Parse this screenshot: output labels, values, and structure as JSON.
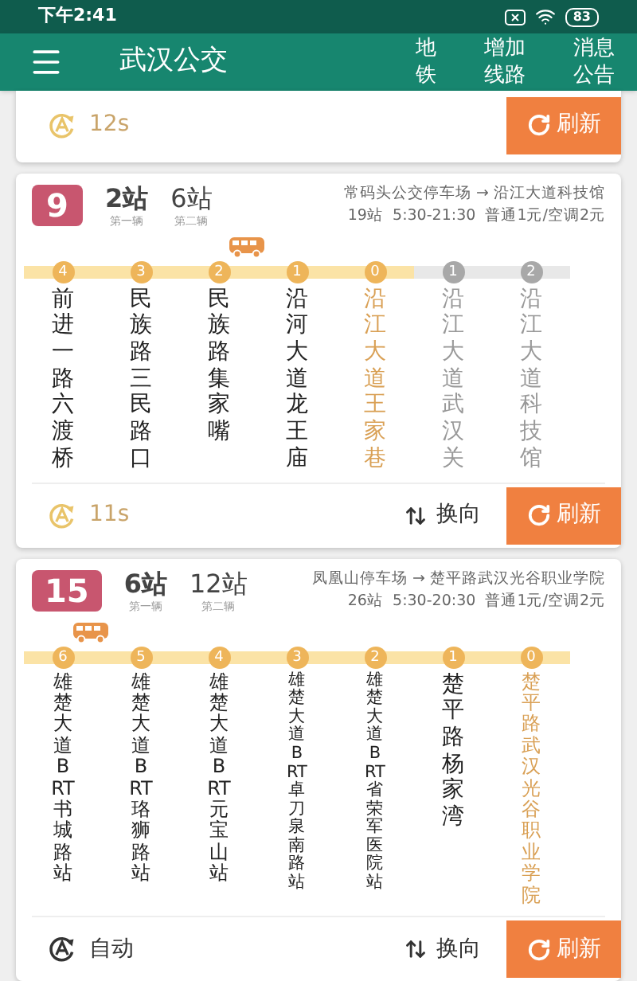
{
  "status_bar": {
    "time": "下午2:41",
    "battery": "83"
  },
  "app_bar": {
    "title": "武汉公交",
    "actions": [
      {
        "lines": [
          "地",
          "铁"
        ]
      },
      {
        "lines": [
          "增加",
          "线路"
        ]
      },
      {
        "lines": [
          "消息",
          "公告"
        ]
      }
    ]
  },
  "cards": [
    {
      "kind": "footer_only",
      "auto_refresh": false,
      "footer_label": "12s",
      "refresh": "刷新"
    },
    {
      "kind": "line",
      "route": "9",
      "first_bus": {
        "stops": "2站",
        "label": "第一辆"
      },
      "second_bus": {
        "stops": "6站",
        "label": "第二辆"
      },
      "direction": "常码头公交停车场 → 沿江大道科技馆",
      "info": "19站  5:30-21:30  普通1元/空调2元",
      "stations": [
        {
          "count": "4",
          "name": "前进一路六渡桥",
          "reached": true,
          "current": false,
          "bus": false
        },
        {
          "count": "3",
          "name": "民族路三民路口",
          "reached": true,
          "current": false,
          "bus": false
        },
        {
          "count": "2",
          "name": "民族路集家嘴",
          "reached": true,
          "current": false,
          "bus": true
        },
        {
          "count": "1",
          "name": "沿河大道龙王庙",
          "reached": true,
          "current": false,
          "bus": false
        },
        {
          "count": "0",
          "name": "沿江大道王家巷",
          "reached": true,
          "current": true,
          "bus": false
        },
        {
          "count": "1",
          "name": "沿江大道武汉关",
          "reached": false,
          "current": false,
          "bus": false
        },
        {
          "count": "2",
          "name": "沿江大道科技馆",
          "reached": false,
          "current": false,
          "bus": false
        }
      ],
      "auto_refresh": false,
      "footer_label": "11s",
      "switch": "换向",
      "refresh": "刷新"
    },
    {
      "kind": "line",
      "route": "15",
      "first_bus": {
        "stops": "6站",
        "label": "第一辆"
      },
      "second_bus": {
        "stops": "12站",
        "label": "第二辆"
      },
      "direction": "凤凰山停车场 → 楚平路武汉光谷职业学院",
      "info": "26站  5:30-20:30  普通1元/空调2元",
      "stations": [
        {
          "count": "6",
          "name": "雄楚大道BRT书城路站",
          "reached": true,
          "current": false,
          "bus": true
        },
        {
          "count": "5",
          "name": "雄楚大道BRT珞狮路站",
          "reached": true,
          "current": false,
          "bus": false
        },
        {
          "count": "4",
          "name": "雄楚大道BRT元宝山站",
          "reached": true,
          "current": false,
          "bus": false
        },
        {
          "count": "3",
          "name": "雄楚大道BRT卓刀泉南路站",
          "reached": true,
          "current": false,
          "bus": false
        },
        {
          "count": "2",
          "name": "雄楚大道BRT省荣军医院站",
          "reached": true,
          "current": false,
          "bus": false
        },
        {
          "count": "1",
          "name": "楚平路杨家湾",
          "reached": true,
          "current": false,
          "bus": false
        },
        {
          "count": "0",
          "name": "楚平路武汉光谷职业学院",
          "reached": true,
          "current": true,
          "bus": false
        }
      ],
      "auto_refresh": true,
      "footer_label": "自动",
      "switch": "换向",
      "refresh": "刷新"
    }
  ]
}
